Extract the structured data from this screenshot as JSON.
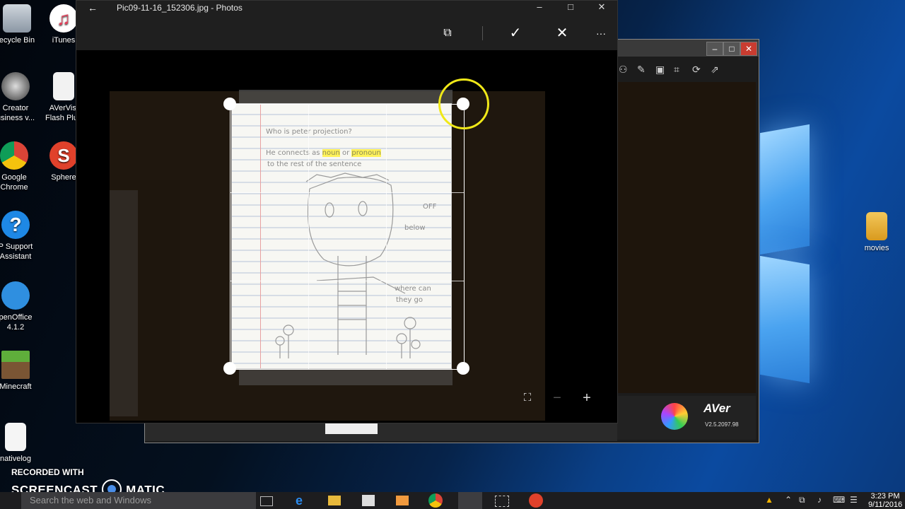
{
  "desktop": {
    "icons": [
      {
        "label": "ecycle Bin"
      },
      {
        "label": "iTunes"
      },
      {
        "label": "Creator\nusiness v..."
      },
      {
        "label": "AVerVisi\nFlash Plug"
      },
      {
        "label": "Google\nChrome"
      },
      {
        "label": "Sphere"
      },
      {
        "label": "P Support\nAssistant"
      },
      {
        "label": "penOffice\n4.1.2"
      },
      {
        "label": "Minecraft"
      },
      {
        "label": "nativelog"
      },
      {
        "label": "movies"
      }
    ]
  },
  "aver": {
    "brand": "AVer",
    "version": "V2.5.2097.98",
    "minimize": "–",
    "maximize": "□",
    "close": "✕"
  },
  "photos": {
    "back": "←",
    "title": "Pic09-11-16_152306.jpg - Photos",
    "window_minimize": "–",
    "window_maximize": "□",
    "window_close": "✕",
    "aspect_ratio_icon": "⧉",
    "accept_icon": "✓",
    "cancel_icon": "✕",
    "more_icon": "···",
    "fit_icon": "⛶",
    "zoom_out": "−",
    "zoom_in": "+",
    "paper_text": {
      "line1": "Who is peter projection?",
      "line2a": "He connects",
      "line2b": "as",
      "hl1": "noun",
      "line2c": "or",
      "hl2": "pronoun",
      "line3": "to the rest of the sentence",
      "off": "OFF",
      "below": "below",
      "where": "where can",
      "they": "they go"
    }
  },
  "watermark": {
    "line1": "RECORDED WITH",
    "left": "SCREENCAST",
    "right": "MATIC"
  },
  "taskbar": {
    "search_placeholder": "Search the web and Windows",
    "time": "3:23 PM",
    "date": "9/11/2016"
  }
}
